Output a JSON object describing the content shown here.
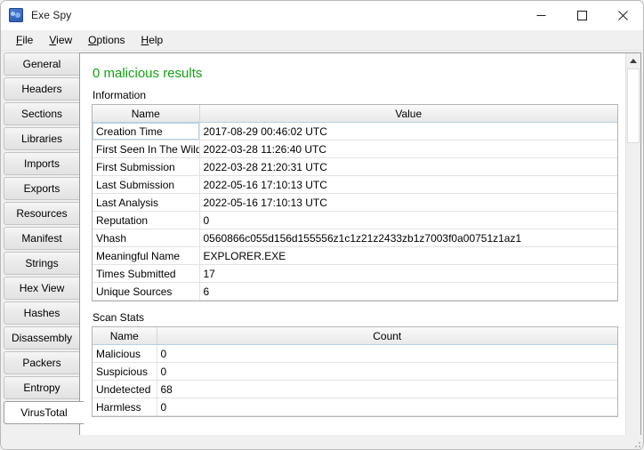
{
  "window": {
    "title": "Exe Spy",
    "icon": "app-icon",
    "minimize_label": "—",
    "maximize_label": "□",
    "close_label": "✕"
  },
  "menubar": {
    "items": [
      {
        "label": "File",
        "accel": "F"
      },
      {
        "label": "View",
        "accel": "V"
      },
      {
        "label": "Options",
        "accel": "O"
      },
      {
        "label": "Help",
        "accel": "H"
      }
    ]
  },
  "tabs": {
    "selected": "VirusTotal",
    "items": [
      {
        "label": "General"
      },
      {
        "label": "Headers"
      },
      {
        "label": "Sections"
      },
      {
        "label": "Libraries"
      },
      {
        "label": "Imports"
      },
      {
        "label": "Exports"
      },
      {
        "label": "Resources"
      },
      {
        "label": "Manifest"
      },
      {
        "label": "Strings"
      },
      {
        "label": "Hex View"
      },
      {
        "label": "Hashes"
      },
      {
        "label": "Disassembly"
      },
      {
        "label": "Packers"
      },
      {
        "label": "Entropy"
      },
      {
        "label": "VirusTotal"
      }
    ]
  },
  "content": {
    "result_title": "0 malicious results",
    "result_title_color": "#13a313",
    "information": {
      "group_label": "Information",
      "columns": [
        "Name",
        "Value"
      ],
      "rows": [
        {
          "name": "Creation Time",
          "value": "2017-08-29 00:46:02 UTC",
          "selected": true
        },
        {
          "name": "First Seen In The Wild",
          "value": "2022-03-28 11:26:40 UTC",
          "selected": false
        },
        {
          "name": "First Submission",
          "value": "2022-03-28 21:20:31 UTC",
          "selected": false
        },
        {
          "name": "Last Submission",
          "value": "2022-05-16 17:10:13 UTC",
          "selected": false
        },
        {
          "name": "Last Analysis",
          "value": "2022-05-16 17:10:13 UTC",
          "selected": false
        },
        {
          "name": "Reputation",
          "value": "0",
          "selected": false
        },
        {
          "name": "Vhash",
          "value": "0560866c055d156d155556z1c1z21z2433zb1z7003f0a00751z1az1",
          "selected": false
        },
        {
          "name": "Meaningful Name",
          "value": "EXPLORER.EXE",
          "selected": false
        },
        {
          "name": "Times Submitted",
          "value": "17",
          "selected": false
        },
        {
          "name": "Unique Sources",
          "value": "6",
          "selected": false
        }
      ]
    },
    "scan_stats": {
      "group_label": "Scan Stats",
      "columns": [
        "Name",
        "Count"
      ],
      "rows": [
        {
          "name": "Malicious",
          "value": "0"
        },
        {
          "name": "Suspicious",
          "value": "0"
        },
        {
          "name": "Undetected",
          "value": "68"
        },
        {
          "name": "Harmless",
          "value": "0"
        }
      ]
    },
    "scrollbar": {
      "up_arrow": "scroll-up-arrow",
      "down_arrow": "scroll-down-arrow"
    }
  }
}
